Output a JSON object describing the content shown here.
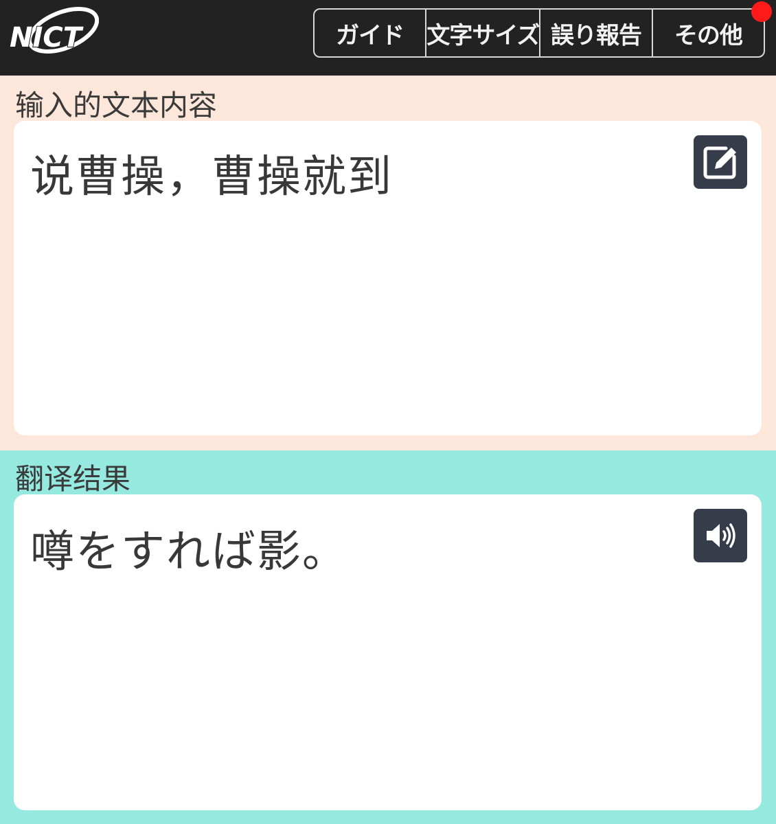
{
  "header": {
    "logo_text": "NICT",
    "nav": [
      {
        "label": "ガイド",
        "icon": ""
      },
      {
        "label": "文字サイズ",
        "icon": ""
      },
      {
        "label": "誤り報告",
        "icon": ""
      },
      {
        "label": "その他",
        "icon": "",
        "has_notification": true
      }
    ]
  },
  "input": {
    "label": "输入的文本内容",
    "text": "说曹操，曹操就到",
    "action_icon": "edit-icon"
  },
  "output": {
    "label": "翻译结果",
    "text": "噂をすれば影。",
    "action_icon": "speaker-icon"
  },
  "colors": {
    "header_bg": "#222222",
    "input_bg": "#fde6da",
    "output_bg": "#95e9df",
    "icon_button_bg": "#363c49",
    "notification": "#ff1a1a"
  }
}
